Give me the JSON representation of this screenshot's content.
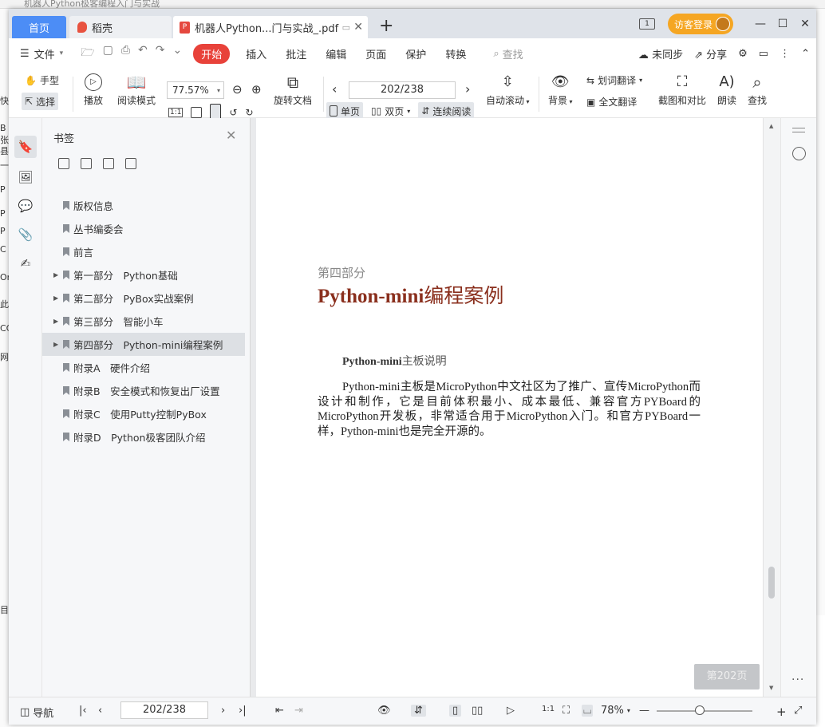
{
  "background_window": {
    "title": "机器人Python极客编程入门与实战",
    "strip_chars": [
      "快",
      "B",
      "张",
      "县",
      "一",
      "P",
      "P",
      "P",
      "C",
      "Or",
      "此",
      "CC",
      "网",
      "目"
    ]
  },
  "tabs": {
    "home": "首页",
    "daoke": "稻壳",
    "document": "机器人Python...门与实战_.pdf",
    "add": "+"
  },
  "window": {
    "visitor_login": "访客登录",
    "layout_icon": "1"
  },
  "menu": {
    "file": "文件",
    "items": [
      "开始",
      "插入",
      "批注",
      "编辑",
      "页面",
      "保护",
      "转换"
    ],
    "active": "开始",
    "search": "查找",
    "sync": "未同步",
    "share": "分享"
  },
  "toolbar": {
    "hand": "手型",
    "select": "选择",
    "play": "播放",
    "read_mode": "阅读模式",
    "zoom_value": "77.57%",
    "one_to_one": "1:1",
    "rotate": "旋转文档",
    "page_value": "202/238",
    "single": "单页",
    "double": "双页",
    "continuous": "连续阅读",
    "auto_scroll": "自动滚动",
    "background": "背景",
    "word_translate": "划词翻译",
    "full_translate": "全文翻译",
    "screenshot_compare": "截图和对比",
    "read_aloud": "朗读",
    "find": "查找"
  },
  "bookmarks": {
    "title": "书签",
    "items": [
      {
        "label": "版权信息",
        "expandable": false,
        "selected": false
      },
      {
        "label": "丛书编委会",
        "expandable": false,
        "selected": false
      },
      {
        "label": "前言",
        "expandable": false,
        "selected": false
      },
      {
        "label": "第一部分　Python基础",
        "expandable": true,
        "selected": false
      },
      {
        "label": "第二部分　PyBox实战案例",
        "expandable": true,
        "selected": false
      },
      {
        "label": "第三部分　智能小车",
        "expandable": true,
        "selected": false
      },
      {
        "label": "第四部分　Python-mini编程案例",
        "expandable": true,
        "selected": true
      },
      {
        "label": "附录A　硬件介绍",
        "expandable": false,
        "selected": false
      },
      {
        "label": "附录B　安全模式和恢复出厂设置",
        "expandable": false,
        "selected": false
      },
      {
        "label": "附录C　使用Putty控制PyBox",
        "expandable": false,
        "selected": false
      },
      {
        "label": "附录D　Python极客团队介绍",
        "expandable": false,
        "selected": false
      }
    ]
  },
  "document": {
    "part_label": "第四部分",
    "heading_latin": "Python-mini",
    "heading_cn": "编程案例",
    "subhead_latin": "Python-mini",
    "subhead_cn": "主板说明",
    "paragraph": "Python-mini主板是MicroPython中文社区为了推广、宣传MicroPython而设计和制作，它是目前体积最小、成本最低、兼容官方PYBoard的MicroPython开发板，非常适合用于MicroPython入门。和官方PYBoard一样，Python-mini也是完全开源的。",
    "page_tag": "第202页"
  },
  "statusbar": {
    "nav": "导航",
    "page_value": "202/238",
    "zoom": "78%",
    "zoom_slider_fraction": 0.45,
    "more": "···"
  },
  "colors": {
    "accent_tab": "#4c8df6",
    "active_menu": "#e8423a",
    "visitor": "#f5a623",
    "heading": "#8a2f1d"
  }
}
